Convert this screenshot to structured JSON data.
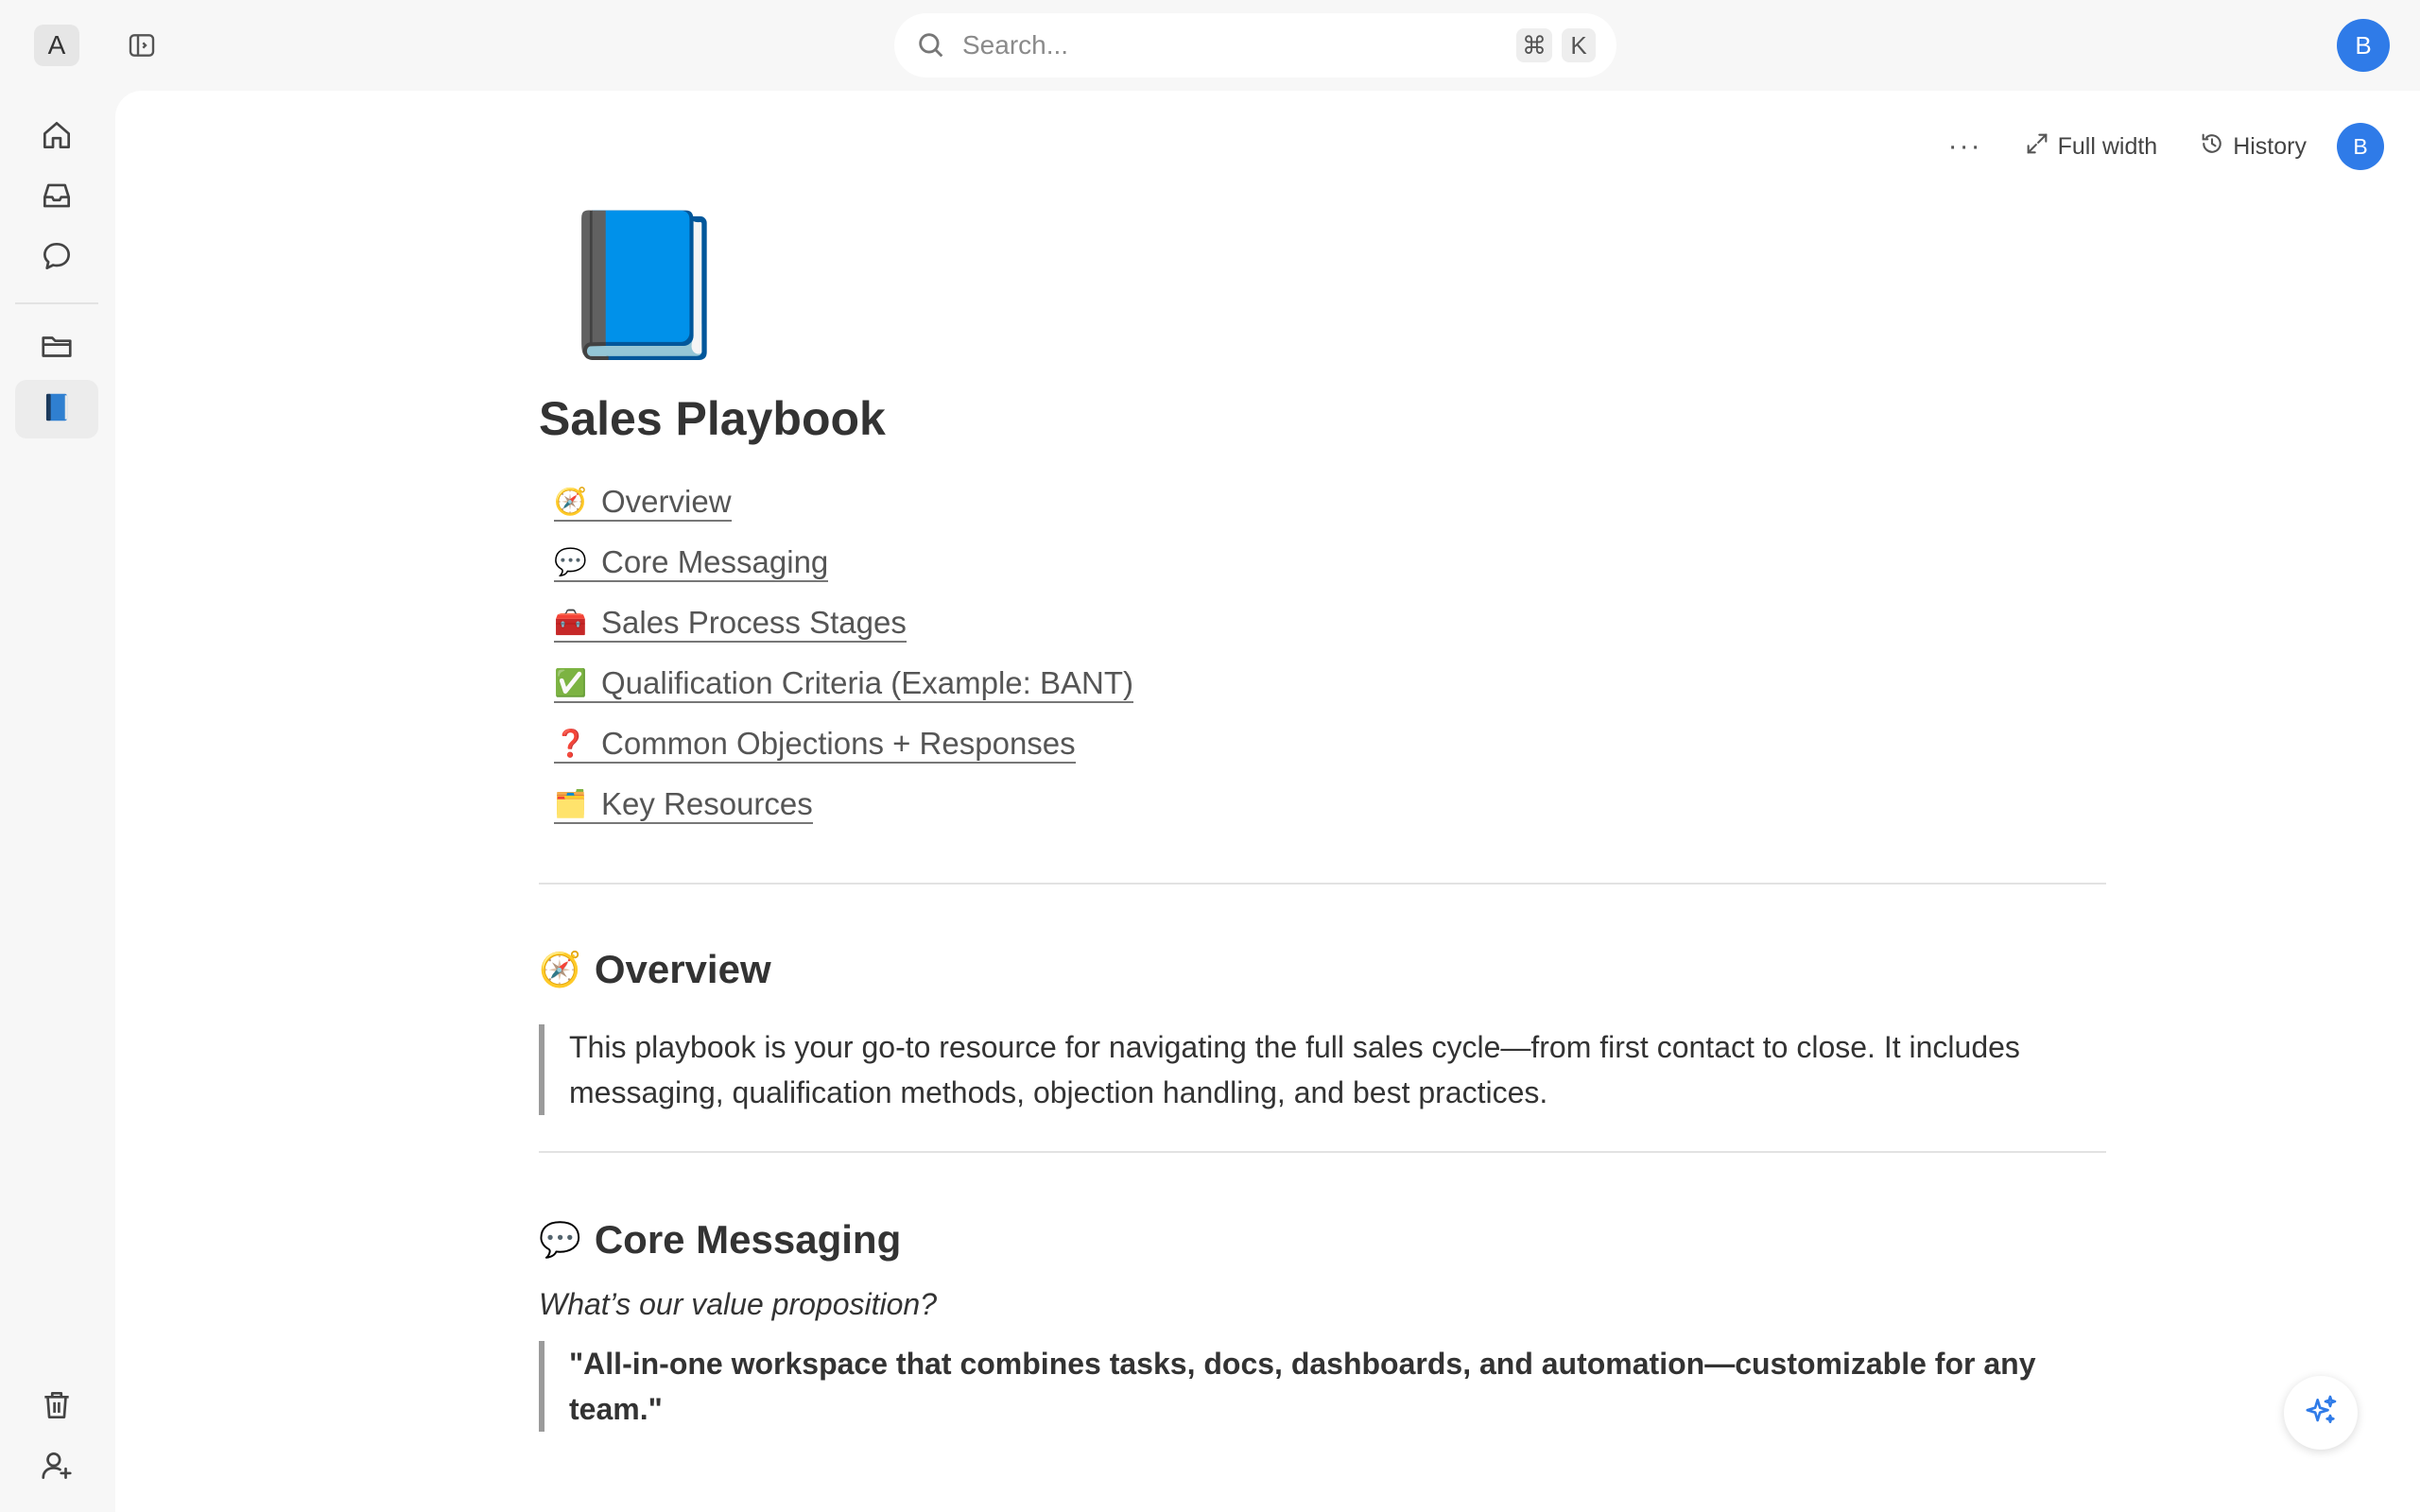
{
  "workspace": {
    "badge": "A"
  },
  "search": {
    "placeholder": "Search...",
    "shortcut_cmd": "⌘",
    "shortcut_key": "K"
  },
  "user": {
    "initial": "B"
  },
  "rail": {
    "items": [
      {
        "icon": "home-icon"
      },
      {
        "icon": "inbox-icon"
      },
      {
        "icon": "chat-icon"
      },
      {
        "icon": "folder-icon"
      },
      {
        "icon": "book-icon",
        "active": true
      }
    ],
    "bottom": [
      {
        "icon": "trash-icon"
      },
      {
        "icon": "add-user-icon"
      }
    ]
  },
  "page_actions": {
    "more": "···",
    "full_width": "Full width",
    "history": "History"
  },
  "doc": {
    "icon": "📘",
    "title": "Sales Playbook",
    "toc": [
      {
        "emoji": "🧭",
        "label": "Overview"
      },
      {
        "emoji": "💬",
        "label": "Core Messaging"
      },
      {
        "emoji": "🧰",
        "label": "Sales Process Stages"
      },
      {
        "emoji": "✅",
        "label": "Qualification Criteria (Example: BANT)"
      },
      {
        "emoji": "❓",
        "label": "Common Objections + Responses"
      },
      {
        "emoji": "🗂️",
        "label": "Key Resources"
      }
    ],
    "overview": {
      "emoji": "🧭",
      "heading": "Overview",
      "quote": "This playbook is your go-to resource for navigating the full sales cycle—from first contact to close. It includes messaging, qualification methods, objection handling, and best practices."
    },
    "core_messaging": {
      "emoji": "💬",
      "heading": "Core Messaging",
      "question": "What’s our value proposition?",
      "quote": "\"All-in-one workspace that combines tasks, docs, dashboards, and automation—customizable for any team.\""
    }
  },
  "colors": {
    "accent": "#2f7be8",
    "background": "#f7f7f7",
    "panel": "#ffffff"
  }
}
